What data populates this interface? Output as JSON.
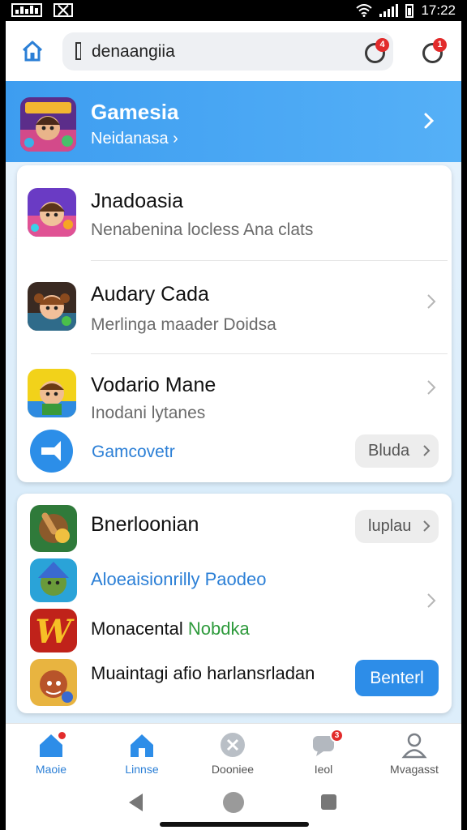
{
  "status_bar": {
    "time": "17:22",
    "icons": [
      "gallery-icon",
      "close-box-icon",
      "wifi-icon",
      "signal-icon",
      "battery-icon"
    ]
  },
  "top_bar": {
    "search_text": "denaangiia",
    "notif_badge_1": "4",
    "notif_badge_2": "1"
  },
  "hero": {
    "title": "Gamesia",
    "subtitle": "Neidanasa ›"
  },
  "list_card": {
    "items": [
      {
        "title": "Jnadoasia",
        "subtitle": "Nenabenina locless Ana clats"
      },
      {
        "title": "Audary Cada",
        "subtitle": "Merlinga maader Doidsa"
      },
      {
        "title": "Vodario Mane",
        "subtitle": "Inodani lytanes"
      }
    ],
    "footer_label": "Gamcovetr",
    "footer_button": "Bluda"
  },
  "games_card": {
    "items": [
      {
        "title": "Bnerloonian",
        "button": "luplau"
      },
      {
        "title": "Aloeaisionrilly Paodeo"
      },
      {
        "title_part1": "Monacental",
        "title_part2": "Nobdka"
      },
      {
        "title": "Muaintagi afio harlansrladan",
        "button": "Benterl"
      }
    ]
  },
  "bottom_nav": {
    "items": [
      {
        "label": "Maoie",
        "icon": "home-icon"
      },
      {
        "label": "Linnse",
        "icon": "home-icon"
      },
      {
        "label": "Dooniee",
        "icon": "games-icon"
      },
      {
        "label": "Ieol",
        "icon": "chat-icon",
        "badge": "3"
      },
      {
        "label": "Mvagasst",
        "icon": "profile-icon"
      }
    ]
  },
  "colors": {
    "accent": "#2d8de8",
    "hero": "#3d9df0",
    "badge": "#e22b2b",
    "link_green": "#2e9a3c"
  }
}
